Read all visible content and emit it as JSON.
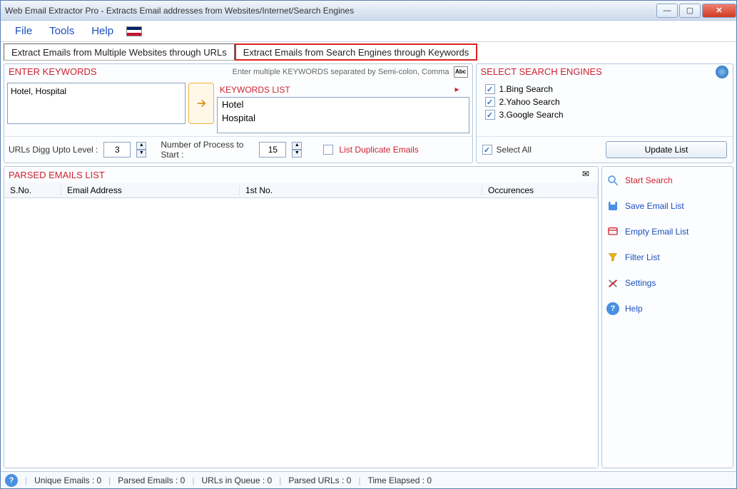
{
  "window": {
    "title": "Web Email Extractor Pro - Extracts Email addresses from Websites/Internet/Search Engines"
  },
  "menu": {
    "file": "File",
    "tools": "Tools",
    "help": "Help"
  },
  "tabs": {
    "urls": "Extract Emails from Multiple Websites through URLs",
    "keywords": "Extract Emails from Search Engines through Keywords"
  },
  "keywords": {
    "title": "ENTER KEYWORDS",
    "hint": "Enter multiple KEYWORDS separated by Semi-colon, Comma",
    "input": "Hotel, Hospital",
    "list_title": "KEYWORDS LIST",
    "items": [
      "Hotel",
      "Hospital"
    ],
    "digg_label": "URLs Digg Upto Level :",
    "digg_value": "3",
    "proc_label": "Number of Process to Start :",
    "proc_value": "15",
    "dup_label": "List Duplicate Emails"
  },
  "engines": {
    "title": "SELECT SEARCH ENGINES",
    "items": [
      "1.Bing Search",
      "2.Yahoo Search",
      "3.Google Search"
    ],
    "select_all": "Select All",
    "update": "Update List"
  },
  "parsed": {
    "title": "PARSED EMAILS LIST",
    "cols": {
      "sno": "S.No.",
      "email": "Email Address",
      "first": "1st No.",
      "occur": "Occurences"
    }
  },
  "actions": {
    "start": "Start Search",
    "save": "Save Email List",
    "empty": "Empty Email List",
    "filter": "Filter List",
    "settings": "Settings",
    "help": "Help"
  },
  "status": {
    "unique": "Unique Emails :  0",
    "parsed": "Parsed Emails :  0",
    "queue": "URLs in Queue :  0",
    "purls": "Parsed URLs :  0",
    "time": "Time Elapsed :  0"
  }
}
